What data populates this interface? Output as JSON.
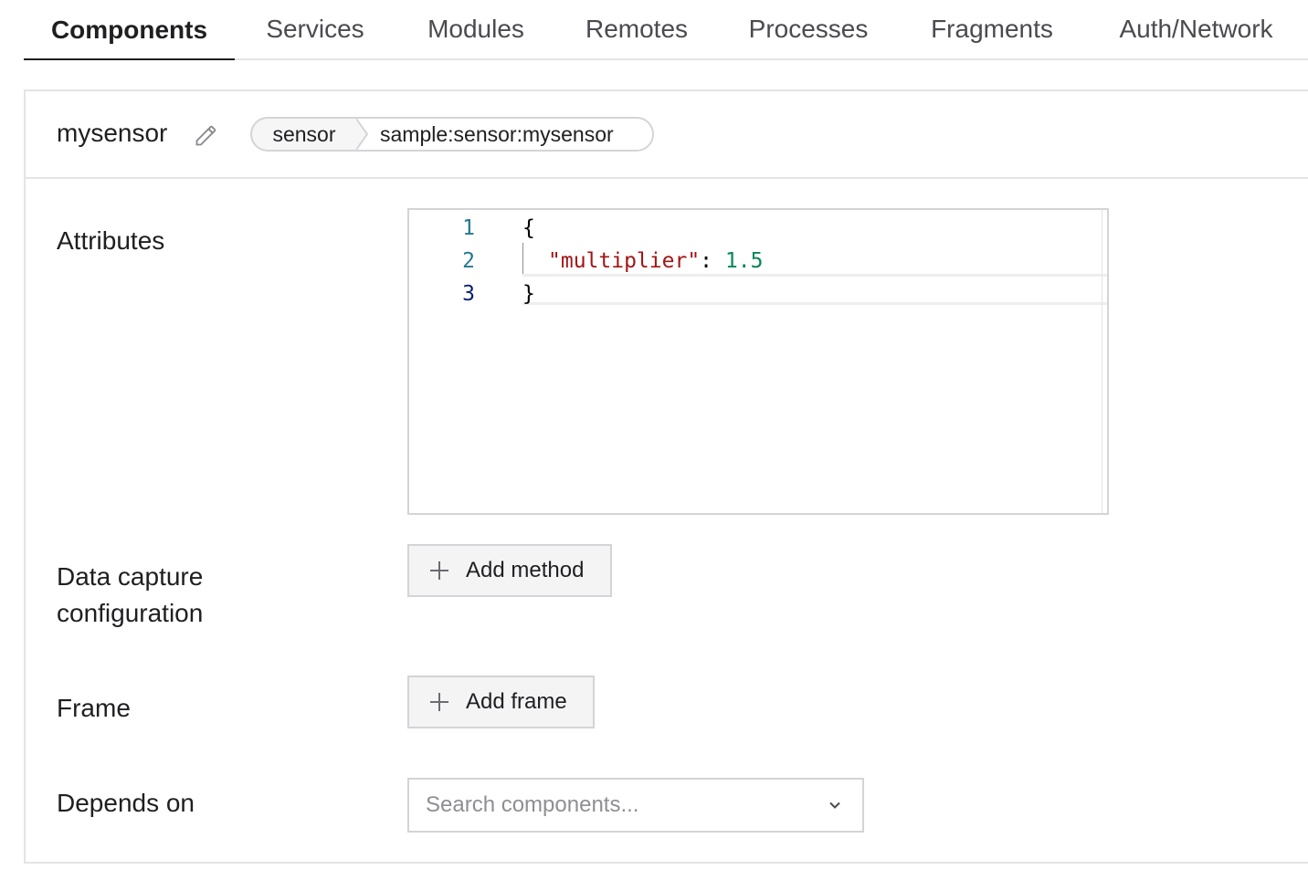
{
  "tabs": [
    {
      "label": "Components",
      "active": true
    },
    {
      "label": "Services",
      "active": false
    },
    {
      "label": "Modules",
      "active": false
    },
    {
      "label": "Remotes",
      "active": false
    },
    {
      "label": "Processes",
      "active": false
    },
    {
      "label": "Fragments",
      "active": false
    },
    {
      "label": "Auth/Network",
      "active": false
    }
  ],
  "component": {
    "name": "mysensor",
    "type": "sensor",
    "model": "sample:sensor:mysensor"
  },
  "attributes": {
    "label": "Attributes",
    "code_lines": [
      {
        "number": "1",
        "open": "{"
      },
      {
        "number": "2",
        "key": "\"multiplier\"",
        "colon": ": ",
        "value": "1.5"
      },
      {
        "number": "3",
        "close": "}"
      }
    ]
  },
  "data_capture": {
    "label_line1": "Data capture",
    "label_line2": "configuration",
    "button_label": "Add method"
  },
  "frame": {
    "label": "Frame",
    "button_label": "Add frame"
  },
  "depends_on": {
    "label": "Depends on",
    "placeholder": "Search components..."
  },
  "colors": {
    "string": "#a31515",
    "number": "#098658",
    "line_number": "#237893"
  },
  "icons": {
    "edit": "pencil-icon",
    "add": "plus-icon",
    "dropdown": "chevron-down-icon"
  }
}
